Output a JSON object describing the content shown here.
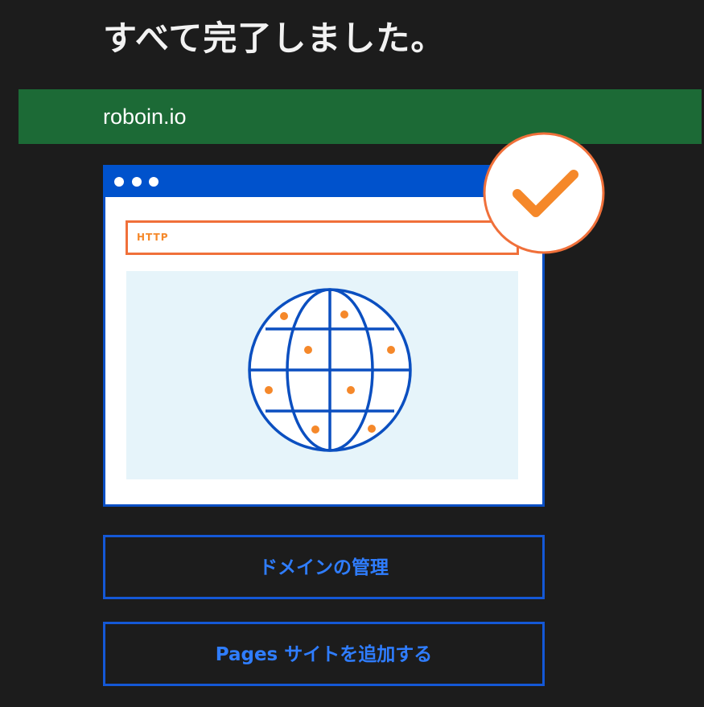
{
  "header": {
    "title": "すべて完了しました。"
  },
  "domain": {
    "name": "roboin.io"
  },
  "illustration": {
    "protocol_label": "HTTP",
    "icons": [
      "window-dots-icon",
      "checkmark-icon",
      "globe-icon"
    ],
    "colors": {
      "window_bar": "#0052cc",
      "window_border": "#0a4fc4",
      "address_border": "#f0703a",
      "accent_orange": "#f5882a",
      "globe_stroke": "#0b4fc0",
      "content_bg": "#e6f4fa"
    }
  },
  "actions": {
    "manage_domain_label": "ドメインの管理",
    "add_pages_site_label": "Pages サイトを追加する"
  },
  "colors": {
    "background": "#1c1c1c",
    "banner": "#1c6a36",
    "button_border": "#1458d6",
    "button_text": "#2f7dff"
  }
}
